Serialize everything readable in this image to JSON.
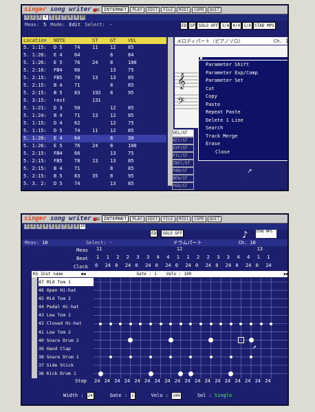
{
  "s1": {
    "logo_a": "singer",
    "logo_b": "song writer",
    "inet": "INTERNET",
    "menus": [
      "PLAY",
      "EDIT",
      "FILE",
      "MIDI",
      "COPD",
      "QUIT"
    ],
    "tracks": [
      "1",
      "2",
      "3",
      "4",
      "5",
      "6",
      "7",
      "8",
      "9",
      "10"
    ],
    "meas_label": "Meas:",
    "meas_val": "5",
    "mode_label": "Mode:",
    "mode_val": "Edit",
    "select_label": "Select:",
    "select_val": "-",
    "tools": [
      "ED",
      "SP",
      "SOLO OFF",
      "3/4",
      "4/4",
      "1/4",
      "STAD MPS"
    ],
    "cols": [
      "Location",
      "NOTE",
      "ST",
      "GT",
      "VEL"
    ],
    "rows": [
      [
        "5. 1:15:",
        "D 5",
        "74",
        "11",
        "12",
        "85"
      ],
      [
        "5. 1:26:",
        "E 4",
        "64",
        "",
        "8",
        "84"
      ],
      [
        "5. 1:26:",
        "E 5",
        "76",
        "24",
        "8",
        "100"
      ],
      [
        "5. 2:16:",
        "FB4",
        "66",
        "",
        "13",
        "75"
      ],
      [
        "5. 2:15:",
        "FB5",
        "78",
        "13",
        "13",
        "85"
      ],
      [
        "5. 2:15:",
        "B 4",
        "71",
        "",
        "8",
        "85"
      ],
      [
        "5. 2:15:",
        "B 5",
        "83",
        "192",
        "8",
        "95"
      ],
      [
        "5. 3:15:",
        "rest",
        "",
        "131",
        "",
        ""
      ],
      [
        "5. 1:21:",
        "D 3",
        "50",
        "",
        "12",
        "85"
      ],
      [
        "5. 1:24:",
        "B 4",
        "71",
        "13",
        "12",
        "85"
      ],
      [
        "5. 1:15:",
        "D 4",
        "62",
        "",
        "12",
        "75"
      ],
      [
        "5. 1:15:",
        "D 5",
        "74",
        "11",
        "12",
        "85"
      ],
      [
        "5. 1:26:",
        "E 4",
        "64",
        "",
        "8",
        "30"
      ],
      [
        "5. 1:26:",
        "E 5",
        "76",
        "24",
        "8",
        "100"
      ],
      [
        "5. 2:15:",
        "FB4",
        "66",
        "",
        "13",
        "75"
      ],
      [
        "5. 2:15:",
        "FB5",
        "78",
        "13",
        "13",
        "85"
      ],
      [
        "5. 2:15:",
        "B 4",
        "71",
        "",
        "8",
        "85"
      ],
      [
        "5. 2:15:",
        "B 5",
        "83",
        "35",
        "8",
        "95"
      ],
      [
        "5. 3. 2:",
        "D 5",
        "74",
        "",
        "13",
        "85"
      ]
    ],
    "part_name": "メロディパート（ピアノソロ）",
    "ch": "Ch. 1",
    "popup": [
      "Parameter Shift",
      "Parameter Exp/Comp",
      "Parameter Set",
      "Cut",
      "Copy",
      "Paste",
      "Repeat Paste",
      "Delete 1 Line",
      "Search",
      "Track Merge",
      "Erase",
      "Close"
    ],
    "side_btns": [
      "VEL/GT",
      "KEY/GT",
      "EXP/GT",
      "PIC/ST",
      "INST/ST",
      "PAN/ST",
      "BEN/ST",
      "PED/ST"
    ]
  },
  "s2": {
    "logo_a": "singer",
    "logo_b": "song writer",
    "inet": "INTERNET",
    "menus": [
      "PLAY",
      "EDIT",
      "FILE",
      "MIDI",
      "COPD",
      "QUIT"
    ],
    "tracks": [
      "1",
      "2",
      "3",
      "4",
      "5",
      "6",
      "7",
      "8",
      "9",
      "10"
    ],
    "meas_label": "Meas:",
    "meas_val": "10",
    "select_label": "Select:",
    "select_val": "-",
    "tools": [
      "ED",
      "SOLO OFF"
    ],
    "part_name": "ドラムパート",
    "ch": "Ch. 10",
    "grid_meas": "Meas",
    "grid_beat": "Beat",
    "grid_clock": "Clock",
    "meas_marks": [
      "11",
      "12",
      "13"
    ],
    "beats": [
      "1",
      "1",
      "2",
      "2",
      "3",
      "3",
      "4",
      "4",
      "1",
      "1",
      "2",
      "2",
      "3",
      "3",
      "4",
      "4",
      "1",
      "1"
    ],
    "clocks": [
      "0",
      "24",
      "0",
      "24",
      "0",
      "24",
      "0",
      "24",
      "0",
      "24",
      "0",
      "24",
      "0",
      "24",
      "0",
      "24",
      "0",
      "24"
    ],
    "col_kg": "KG",
    "col_inst": "Inst name",
    "gate_label": "Gate :",
    "gate_val": "1",
    "velo_label": "Velo :",
    "velo_val": "100",
    "insts": [
      "47 Mid Tom 1",
      "46 Open Hi-hat",
      "45 Mid Tom 2",
      "44 Pedal Hi-hat",
      "43 Low Tom 1",
      "42 Closed Hi-hat",
      "41 Low Tom 2",
      "40 Snare Drum 2",
      "39 Hand Clap",
      "38 Snare Drum 1",
      "37 Side Stick",
      "36 Kick Drum 1"
    ],
    "step_label": "Step",
    "steps": [
      "24",
      "24",
      "24",
      "24",
      "24",
      "24",
      "24",
      "24",
      "24",
      "24",
      "24",
      "24",
      "24",
      "24",
      "24",
      "24",
      "24",
      "24"
    ],
    "width_label": "Width :",
    "width_val": "24",
    "gate2_label": "Gate :",
    "gate2_val": "1",
    "velo2_label": "Velo :",
    "velo2_val": "100",
    "sel_label": "Sel :",
    "sel_val": "Single"
  }
}
